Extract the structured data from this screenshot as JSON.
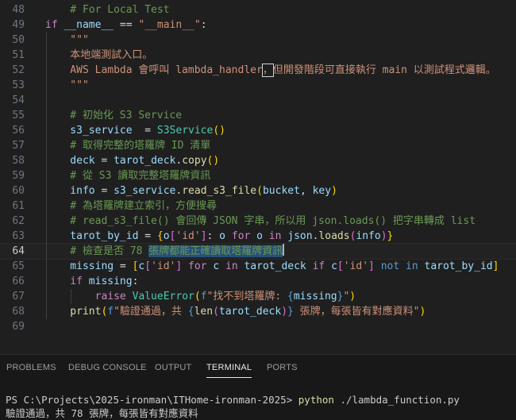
{
  "editor": {
    "current_line": 64,
    "lines": [
      {
        "n": 48,
        "tokens": [
          {
            "t": "    # For Local Test",
            "c": "#6a9955"
          }
        ]
      },
      {
        "n": 49,
        "tokens": [
          {
            "t": "if ",
            "c": "#c586c0"
          },
          {
            "t": "__name__",
            "c": "#9cdcfe"
          },
          {
            "t": " == ",
            "c": "#d4d4d4"
          },
          {
            "t": "\"__main__\"",
            "c": "#ce9178"
          },
          {
            "t": ":",
            "c": "#d4d4d4"
          }
        ]
      },
      {
        "n": 50,
        "tokens": [
          {
            "t": "    \"\"\"",
            "c": "#ce9178"
          }
        ]
      },
      {
        "n": 51,
        "tokens": [
          {
            "t": "    本地端測試入口。",
            "c": "#ce9178"
          }
        ]
      },
      {
        "n": 52,
        "tokens": [
          {
            "t": "    AWS Lambda 會呼叫 lambda_handler",
            "c": "#ce9178"
          },
          {
            "t": "，",
            "c": "#ce9178",
            "box": true
          },
          {
            "t": "但開發階段可直接執行 main 以測試程式邏輯。",
            "c": "#ce9178"
          }
        ]
      },
      {
        "n": 53,
        "tokens": [
          {
            "t": "    \"\"\"",
            "c": "#ce9178"
          }
        ]
      },
      {
        "n": 54,
        "tokens": []
      },
      {
        "n": 55,
        "tokens": [
          {
            "t": "    # 初始化 S3 Service",
            "c": "#6a9955"
          }
        ]
      },
      {
        "n": 56,
        "tokens": [
          {
            "t": "    s3_service",
            "c": "#9cdcfe"
          },
          {
            "t": "  = ",
            "c": "#d4d4d4"
          },
          {
            "t": "S3Service",
            "c": "#4ec9b0"
          },
          {
            "t": "()",
            "c": "#ffd700"
          }
        ]
      },
      {
        "n": 57,
        "tokens": [
          {
            "t": "    # 取得完整的塔羅牌 ID 清單",
            "c": "#6a9955"
          }
        ]
      },
      {
        "n": 58,
        "tokens": [
          {
            "t": "    deck",
            "c": "#9cdcfe"
          },
          {
            "t": " = ",
            "c": "#d4d4d4"
          },
          {
            "t": "tarot_deck",
            "c": "#9cdcfe"
          },
          {
            "t": ".",
            "c": "#d4d4d4"
          },
          {
            "t": "copy",
            "c": "#dcdcaa"
          },
          {
            "t": "()",
            "c": "#ffd700"
          }
        ]
      },
      {
        "n": 59,
        "tokens": [
          {
            "t": "    # 從 S3 讀取完整塔羅牌資訊",
            "c": "#6a9955"
          }
        ]
      },
      {
        "n": 60,
        "tokens": [
          {
            "t": "    info",
            "c": "#9cdcfe"
          },
          {
            "t": " = ",
            "c": "#d4d4d4"
          },
          {
            "t": "s3_service",
            "c": "#9cdcfe"
          },
          {
            "t": ".",
            "c": "#d4d4d4"
          },
          {
            "t": "read_s3_file",
            "c": "#dcdcaa"
          },
          {
            "t": "(",
            "c": "#ffd700"
          },
          {
            "t": "bucket",
            "c": "#9cdcfe"
          },
          {
            "t": ", ",
            "c": "#d4d4d4"
          },
          {
            "t": "key",
            "c": "#9cdcfe"
          },
          {
            "t": ")",
            "c": "#ffd700"
          }
        ]
      },
      {
        "n": 61,
        "tokens": [
          {
            "t": "    # 為塔羅牌建立索引，方便搜尋",
            "c": "#6a9955"
          }
        ]
      },
      {
        "n": 62,
        "tokens": [
          {
            "t": "    # read_s3_file() 會回傳 JSON 字串，所以用 json.loads() 把字串轉成 list",
            "c": "#6a9955"
          }
        ]
      },
      {
        "n": 63,
        "tokens": [
          {
            "t": "    tarot_by_id",
            "c": "#9cdcfe"
          },
          {
            "t": " = ",
            "c": "#d4d4d4"
          },
          {
            "t": "{",
            "c": "#ffd700"
          },
          {
            "t": "o",
            "c": "#9cdcfe"
          },
          {
            "t": "[",
            "c": "#da70d6"
          },
          {
            "t": "'id'",
            "c": "#ce9178"
          },
          {
            "t": "]",
            "c": "#da70d6"
          },
          {
            "t": ": ",
            "c": "#d4d4d4"
          },
          {
            "t": "o",
            "c": "#9cdcfe"
          },
          {
            "t": " for ",
            "c": "#c586c0"
          },
          {
            "t": "o",
            "c": "#9cdcfe"
          },
          {
            "t": " in ",
            "c": "#c586c0"
          },
          {
            "t": "json",
            "c": "#9cdcfe"
          },
          {
            "t": ".",
            "c": "#d4d4d4"
          },
          {
            "t": "loads",
            "c": "#dcdcaa"
          },
          {
            "t": "(",
            "c": "#da70d6"
          },
          {
            "t": "info",
            "c": "#9cdcfe"
          },
          {
            "t": ")",
            "c": "#da70d6"
          },
          {
            "t": "}",
            "c": "#ffd700"
          }
        ]
      },
      {
        "n": 64,
        "tokens": [
          {
            "t": "    # 檢查是否 78 ",
            "c": "#6a9955"
          },
          {
            "t": "張牌都能正確讀取塔羅牌資訊",
            "c": "#6a9955",
            "sel": true
          },
          {
            "t": "",
            "c": "#6a9955",
            "cursor": true
          }
        ]
      },
      {
        "n": 65,
        "tokens": [
          {
            "t": "    missing",
            "c": "#9cdcfe"
          },
          {
            "t": " = ",
            "c": "#d4d4d4"
          },
          {
            "t": "[",
            "c": "#ffd700"
          },
          {
            "t": "c",
            "c": "#9cdcfe"
          },
          {
            "t": "[",
            "c": "#da70d6"
          },
          {
            "t": "'id'",
            "c": "#ce9178"
          },
          {
            "t": "]",
            "c": "#da70d6"
          },
          {
            "t": " for ",
            "c": "#c586c0"
          },
          {
            "t": "c",
            "c": "#9cdcfe"
          },
          {
            "t": " in ",
            "c": "#c586c0"
          },
          {
            "t": "tarot_deck",
            "c": "#9cdcfe"
          },
          {
            "t": " if ",
            "c": "#c586c0"
          },
          {
            "t": "c",
            "c": "#9cdcfe"
          },
          {
            "t": "[",
            "c": "#da70d6"
          },
          {
            "t": "'id'",
            "c": "#ce9178"
          },
          {
            "t": "]",
            "c": "#da70d6"
          },
          {
            "t": " not in ",
            "c": "#569cd6"
          },
          {
            "t": "tarot_by_id",
            "c": "#9cdcfe"
          },
          {
            "t": "]",
            "c": "#ffd700"
          }
        ]
      },
      {
        "n": 66,
        "tokens": [
          {
            "t": "    if ",
            "c": "#c586c0"
          },
          {
            "t": "missing",
            "c": "#9cdcfe"
          },
          {
            "t": ":",
            "c": "#d4d4d4"
          }
        ]
      },
      {
        "n": 67,
        "tokens": [
          {
            "t": "        raise ",
            "c": "#c586c0"
          },
          {
            "t": "ValueError",
            "c": "#4ec9b0"
          },
          {
            "t": "(",
            "c": "#ffd700"
          },
          {
            "t": "f",
            "c": "#569cd6"
          },
          {
            "t": "\"找不到塔羅牌: ",
            "c": "#ce9178"
          },
          {
            "t": "{",
            "c": "#569cd6"
          },
          {
            "t": "missing",
            "c": "#9cdcfe"
          },
          {
            "t": "}",
            "c": "#569cd6"
          },
          {
            "t": "\"",
            "c": "#ce9178"
          },
          {
            "t": ")",
            "c": "#ffd700"
          }
        ]
      },
      {
        "n": 68,
        "tokens": [
          {
            "t": "    print",
            "c": "#dcdcaa"
          },
          {
            "t": "(",
            "c": "#ffd700"
          },
          {
            "t": "f",
            "c": "#569cd6"
          },
          {
            "t": "\"驗證通過，共 ",
            "c": "#ce9178"
          },
          {
            "t": "{",
            "c": "#569cd6"
          },
          {
            "t": "len",
            "c": "#dcdcaa"
          },
          {
            "t": "(",
            "c": "#da70d6"
          },
          {
            "t": "tarot_deck",
            "c": "#9cdcfe"
          },
          {
            "t": ")",
            "c": "#da70d6"
          },
          {
            "t": "}",
            "c": "#569cd6"
          },
          {
            "t": " 張牌，每張皆有對應資料\"",
            "c": "#ce9178"
          },
          {
            "t": ")",
            "c": "#ffd700"
          }
        ]
      },
      {
        "n": 69,
        "tokens": []
      }
    ]
  },
  "panel": {
    "tabs": [
      {
        "label": "PROBLEMS",
        "active": false
      },
      {
        "label": "DEBUG CONSOLE",
        "active": false
      },
      {
        "label": "OUTPUT",
        "active": false
      },
      {
        "label": "TERMINAL",
        "active": true
      },
      {
        "label": "PORTS",
        "active": false
      }
    ],
    "terminal": {
      "prompt": "PS C:\\Projects\\2025-ironman\\ITHome-ironman-2025> ",
      "command_exe": "python",
      "command_args": " ./lambda_function.py",
      "output": "驗證通過，共 78 張牌，每張皆有對應資料"
    }
  },
  "colors": {
    "background": "#1f1f1f",
    "selection": "#264f78",
    "terminal_command": "#dcdcaa"
  }
}
